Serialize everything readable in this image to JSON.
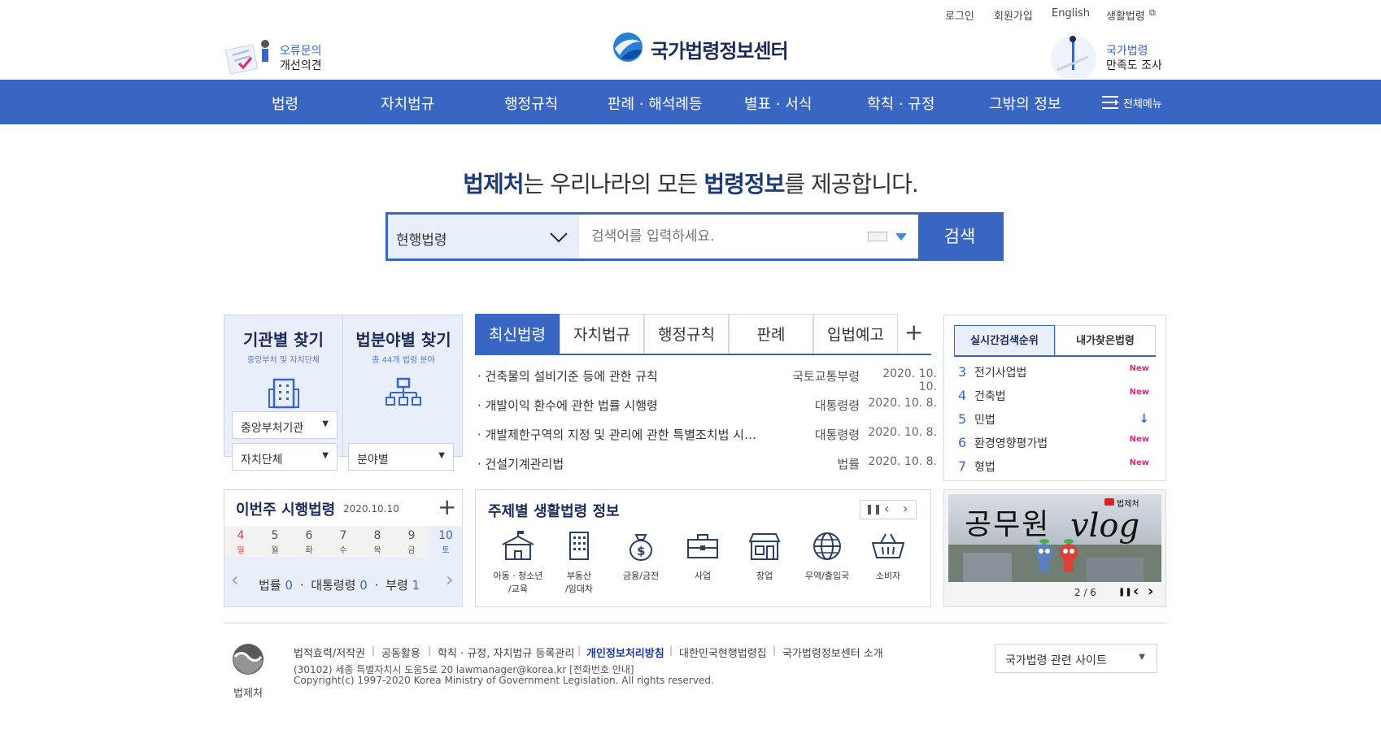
{
  "util_links": {
    "login": "로그인",
    "join": "회원가입",
    "english": "English",
    "life_law": "생활법령"
  },
  "left_banner": {
    "line1": "오류문의",
    "line2": "개선의견"
  },
  "logo": {
    "title": "국가법령정보센터"
  },
  "right_banner": {
    "line1": "국가법령",
    "line2": "만족도 조사"
  },
  "nav": {
    "items": [
      "법령",
      "자치법규",
      "행정규칙",
      "판례 · 해석례등",
      "별표 · 서식",
      "학칙 · 규정",
      "그밖의 정보"
    ],
    "all_menu": "전체메뉴"
  },
  "headline": {
    "part1": "법제처",
    "part2": "는 우리나라의 모든 ",
    "part3": "법령정보",
    "part4": "를 제공합니다."
  },
  "search": {
    "scope": "현행법령",
    "placeholder": "검색어를 입력하세요.",
    "button": "검색"
  },
  "find": {
    "agency_title": "기관별 찾기",
    "agency_sub": "중앙부처 및 자치단체",
    "field_title": "법분야별 찾기",
    "field_sub": "총 44개 법령 분야",
    "select_central": "중앙부처기관",
    "select_local": "자치단체",
    "select_field": "분야별"
  },
  "news_tabs": [
    "최신법령",
    "자치법규",
    "행정규칙",
    "판례",
    "입법예고"
  ],
  "news": [
    {
      "title": "· 건축물의 설비기준 등에 관한 규칙",
      "category": "국토교통부령",
      "date": "2020. 10. 10."
    },
    {
      "title": "· 개발이익 환수에 관한 법률 시행령",
      "category": "대통령령",
      "date": "2020. 10. 8."
    },
    {
      "title": "· 개발제한구역의 지정 및 관리에 관한 특별조치법 시…",
      "category": "대통령령",
      "date": "2020. 10. 8."
    },
    {
      "title": "· 건설기계관리법",
      "category": "법률",
      "date": "2020. 10. 8."
    }
  ],
  "rank_tabs": {
    "realtime": "실시간검색순위",
    "mine": "내가찾은법령"
  },
  "ranks": [
    {
      "num": "3",
      "label": "전기사업법",
      "status": "New"
    },
    {
      "num": "4",
      "label": "건축법",
      "status": "New"
    },
    {
      "num": "5",
      "label": "민법",
      "status": "↓"
    },
    {
      "num": "6",
      "label": "환경영향평가법",
      "status": "New"
    },
    {
      "num": "7",
      "label": "형법",
      "status": "New"
    }
  ],
  "weekly": {
    "title": "이번주 시행법령",
    "date": "2020.10.10",
    "days": [
      {
        "d": "4",
        "w": "일"
      },
      {
        "d": "5",
        "w": "월"
      },
      {
        "d": "6",
        "w": "화"
      },
      {
        "d": "7",
        "w": "수"
      },
      {
        "d": "8",
        "w": "목"
      },
      {
        "d": "9",
        "w": "금"
      },
      {
        "d": "10",
        "w": "토"
      }
    ],
    "law_label": "법률",
    "law_count": "0",
    "decree_label": "대통령령",
    "decree_count": "0",
    "ministry_label": "부령",
    "ministry_count": "1"
  },
  "topics": {
    "title": "주제별 생활법령 정보",
    "items": [
      {
        "line1": "아동 · 청소년",
        "line2": "/교육"
      },
      {
        "line1": "부동산",
        "line2": "/임대차"
      },
      {
        "line1": "금융/금전",
        "line2": ""
      },
      {
        "line1": "사업",
        "line2": ""
      },
      {
        "line1": "창업",
        "line2": ""
      },
      {
        "line1": "무역/출입국",
        "line2": ""
      },
      {
        "line1": "소비자",
        "line2": ""
      }
    ]
  },
  "vlog": {
    "title": "공무원",
    "subtitle": "vlog",
    "brand": "법제처",
    "page": "2 / 6"
  },
  "footer": {
    "links": [
      "법적효력/저작권",
      "공동활용",
      "학칙 · 규정, 자치법규 등록관리",
      "개인정보처리방침",
      "대한민국현행법령집",
      "국가법령정보센터 소개"
    ],
    "address": "(30102) 세종 특별자치시 도움5로 20 lawmanager@korea.kr [전화번호 안내]",
    "copyright": "Copyright(c) 1997-2020 Korea Ministry of Government Legislation. All rights reserved.",
    "org": "법제처",
    "related": "국가법령 관련 사이트"
  },
  "colors": {
    "primary": "#3a66c3",
    "navy": "#1d2b59",
    "new": "#e5237a"
  }
}
